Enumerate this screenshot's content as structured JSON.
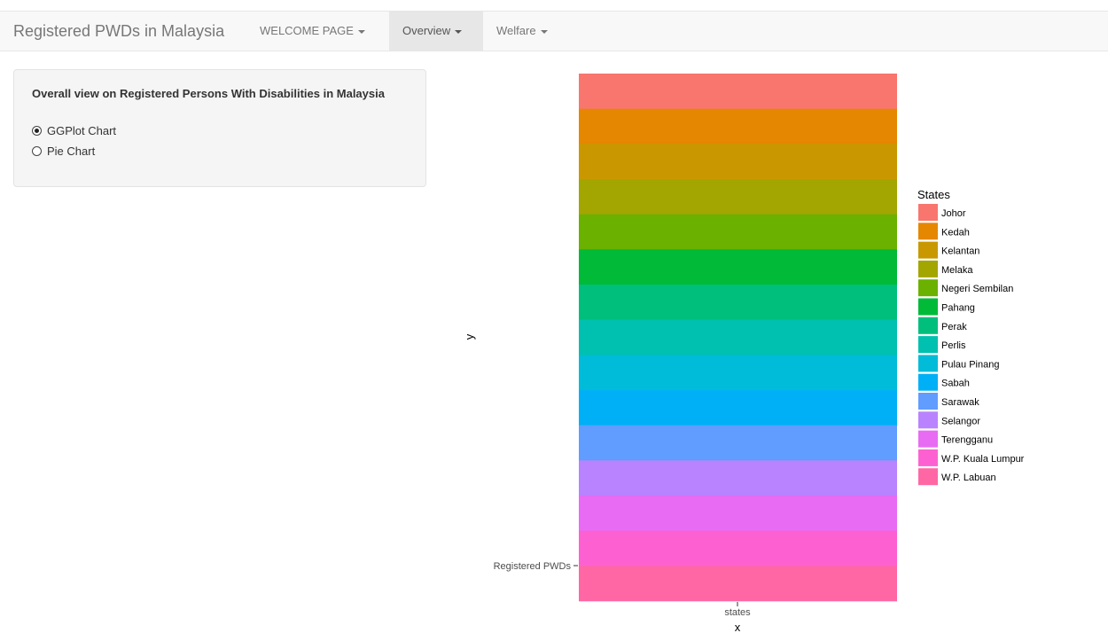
{
  "navbar": {
    "brand": "Registered PWDs in Malaysia",
    "items": [
      {
        "label": "WELCOME PAGE",
        "active": false
      },
      {
        "label": "Overview",
        "active": true
      },
      {
        "label": "Welfare",
        "active": false
      }
    ]
  },
  "sidebar": {
    "title": "Overall view on Registered Persons With Disabilities in Malaysia",
    "options": [
      {
        "label": "GGPlot Chart",
        "selected": true
      },
      {
        "label": "Pie Chart",
        "selected": false
      }
    ]
  },
  "chart_data": {
    "type": "bar",
    "stacked": true,
    "xlabel": "x",
    "ylabel": "y",
    "categories": [
      "states"
    ],
    "y_tick_labels": [
      "Registered PWDs"
    ],
    "legend_title": "States",
    "legend_position": "right",
    "grid": false,
    "series": [
      {
        "name": "Johor",
        "color": "#F8766D",
        "values": [
          1
        ]
      },
      {
        "name": "Kedah",
        "color": "#E58700",
        "values": [
          1
        ]
      },
      {
        "name": "Kelantan",
        "color": "#C99800",
        "values": [
          1
        ]
      },
      {
        "name": "Melaka",
        "color": "#A3A500",
        "values": [
          1
        ]
      },
      {
        "name": "Negeri Sembilan",
        "color": "#6BB100",
        "values": [
          1
        ]
      },
      {
        "name": "Pahang",
        "color": "#00BA38",
        "values": [
          1
        ]
      },
      {
        "name": "Perak",
        "color": "#00BF7D",
        "values": [
          1
        ]
      },
      {
        "name": "Perlis",
        "color": "#00C0AF",
        "values": [
          1
        ]
      },
      {
        "name": "Pulau Pinang",
        "color": "#00BCD8",
        "values": [
          1
        ]
      },
      {
        "name": "Sabah",
        "color": "#00B0F6",
        "values": [
          1
        ]
      },
      {
        "name": "Sarawak",
        "color": "#619CFF",
        "values": [
          1
        ]
      },
      {
        "name": "Selangor",
        "color": "#B983FF",
        "values": [
          1
        ]
      },
      {
        "name": "Terengganu",
        "color": "#E76BF3",
        "values": [
          1
        ]
      },
      {
        "name": "W.P. Kuala Lumpur",
        "color": "#FD61D1",
        "values": [
          1
        ]
      },
      {
        "name": "W.P. Labuan",
        "color": "#FF67A4",
        "values": [
          1
        ]
      }
    ]
  }
}
